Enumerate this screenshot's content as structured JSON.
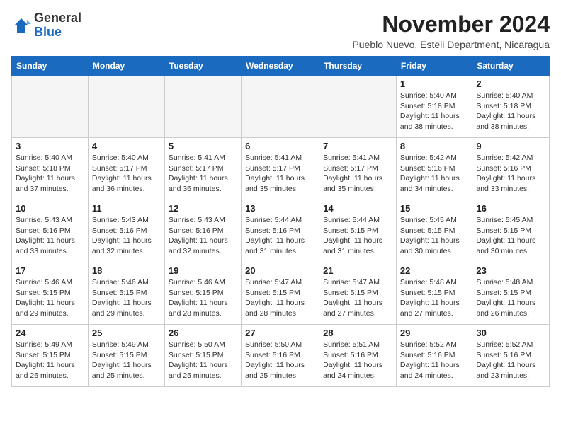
{
  "logo": {
    "general": "General",
    "blue": "Blue"
  },
  "header": {
    "month_title": "November 2024",
    "subtitle": "Pueblo Nuevo, Esteli Department, Nicaragua"
  },
  "weekdays": [
    "Sunday",
    "Monday",
    "Tuesday",
    "Wednesday",
    "Thursday",
    "Friday",
    "Saturday"
  ],
  "weeks": [
    [
      {
        "day": "",
        "text": ""
      },
      {
        "day": "",
        "text": ""
      },
      {
        "day": "",
        "text": ""
      },
      {
        "day": "",
        "text": ""
      },
      {
        "day": "",
        "text": ""
      },
      {
        "day": "1",
        "text": "Sunrise: 5:40 AM\nSunset: 5:18 PM\nDaylight: 11 hours and 38 minutes."
      },
      {
        "day": "2",
        "text": "Sunrise: 5:40 AM\nSunset: 5:18 PM\nDaylight: 11 hours and 38 minutes."
      }
    ],
    [
      {
        "day": "3",
        "text": "Sunrise: 5:40 AM\nSunset: 5:18 PM\nDaylight: 11 hours and 37 minutes."
      },
      {
        "day": "4",
        "text": "Sunrise: 5:40 AM\nSunset: 5:17 PM\nDaylight: 11 hours and 36 minutes."
      },
      {
        "day": "5",
        "text": "Sunrise: 5:41 AM\nSunset: 5:17 PM\nDaylight: 11 hours and 36 minutes."
      },
      {
        "day": "6",
        "text": "Sunrise: 5:41 AM\nSunset: 5:17 PM\nDaylight: 11 hours and 35 minutes."
      },
      {
        "day": "7",
        "text": "Sunrise: 5:41 AM\nSunset: 5:17 PM\nDaylight: 11 hours and 35 minutes."
      },
      {
        "day": "8",
        "text": "Sunrise: 5:42 AM\nSunset: 5:16 PM\nDaylight: 11 hours and 34 minutes."
      },
      {
        "day": "9",
        "text": "Sunrise: 5:42 AM\nSunset: 5:16 PM\nDaylight: 11 hours and 33 minutes."
      }
    ],
    [
      {
        "day": "10",
        "text": "Sunrise: 5:43 AM\nSunset: 5:16 PM\nDaylight: 11 hours and 33 minutes."
      },
      {
        "day": "11",
        "text": "Sunrise: 5:43 AM\nSunset: 5:16 PM\nDaylight: 11 hours and 32 minutes."
      },
      {
        "day": "12",
        "text": "Sunrise: 5:43 AM\nSunset: 5:16 PM\nDaylight: 11 hours and 32 minutes."
      },
      {
        "day": "13",
        "text": "Sunrise: 5:44 AM\nSunset: 5:16 PM\nDaylight: 11 hours and 31 minutes."
      },
      {
        "day": "14",
        "text": "Sunrise: 5:44 AM\nSunset: 5:15 PM\nDaylight: 11 hours and 31 minutes."
      },
      {
        "day": "15",
        "text": "Sunrise: 5:45 AM\nSunset: 5:15 PM\nDaylight: 11 hours and 30 minutes."
      },
      {
        "day": "16",
        "text": "Sunrise: 5:45 AM\nSunset: 5:15 PM\nDaylight: 11 hours and 30 minutes."
      }
    ],
    [
      {
        "day": "17",
        "text": "Sunrise: 5:46 AM\nSunset: 5:15 PM\nDaylight: 11 hours and 29 minutes."
      },
      {
        "day": "18",
        "text": "Sunrise: 5:46 AM\nSunset: 5:15 PM\nDaylight: 11 hours and 29 minutes."
      },
      {
        "day": "19",
        "text": "Sunrise: 5:46 AM\nSunset: 5:15 PM\nDaylight: 11 hours and 28 minutes."
      },
      {
        "day": "20",
        "text": "Sunrise: 5:47 AM\nSunset: 5:15 PM\nDaylight: 11 hours and 28 minutes."
      },
      {
        "day": "21",
        "text": "Sunrise: 5:47 AM\nSunset: 5:15 PM\nDaylight: 11 hours and 27 minutes."
      },
      {
        "day": "22",
        "text": "Sunrise: 5:48 AM\nSunset: 5:15 PM\nDaylight: 11 hours and 27 minutes."
      },
      {
        "day": "23",
        "text": "Sunrise: 5:48 AM\nSunset: 5:15 PM\nDaylight: 11 hours and 26 minutes."
      }
    ],
    [
      {
        "day": "24",
        "text": "Sunrise: 5:49 AM\nSunset: 5:15 PM\nDaylight: 11 hours and 26 minutes."
      },
      {
        "day": "25",
        "text": "Sunrise: 5:49 AM\nSunset: 5:15 PM\nDaylight: 11 hours and 25 minutes."
      },
      {
        "day": "26",
        "text": "Sunrise: 5:50 AM\nSunset: 5:15 PM\nDaylight: 11 hours and 25 minutes."
      },
      {
        "day": "27",
        "text": "Sunrise: 5:50 AM\nSunset: 5:16 PM\nDaylight: 11 hours and 25 minutes."
      },
      {
        "day": "28",
        "text": "Sunrise: 5:51 AM\nSunset: 5:16 PM\nDaylight: 11 hours and 24 minutes."
      },
      {
        "day": "29",
        "text": "Sunrise: 5:52 AM\nSunset: 5:16 PM\nDaylight: 11 hours and 24 minutes."
      },
      {
        "day": "30",
        "text": "Sunrise: 5:52 AM\nSunset: 5:16 PM\nDaylight: 11 hours and 23 minutes."
      }
    ]
  ]
}
